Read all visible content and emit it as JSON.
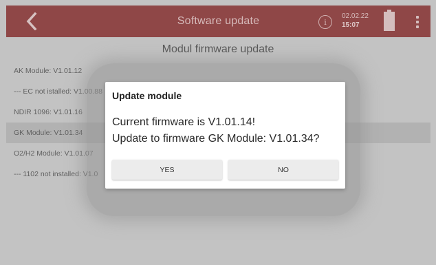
{
  "appbar": {
    "title": "Software update",
    "date": "02.02.22",
    "time": "15:07",
    "icons": [
      "chevron-left-icon",
      "info-icon",
      "battery-icon",
      "more-vertical-icon"
    ],
    "colors": {
      "bar": "#8a2a2a",
      "bar_text": "#e7c2c2"
    }
  },
  "page": {
    "heading": "Modul firmware update",
    "modules": [
      {
        "label": "AK Module: V1.01.12",
        "selected": false
      },
      {
        "label": "--- EC not istalled: V1.00.88",
        "selected": false
      },
      {
        "label": "NDIR 1096: V1.01.16",
        "selected": false
      },
      {
        "label": "GK Module: V1.01.34",
        "selected": true
      },
      {
        "label": "O2/H2 Module: V1.01.07",
        "selected": false
      },
      {
        "label": "--- 1102 not installed: V1.0",
        "selected": false
      }
    ]
  },
  "dialog": {
    "title": "Update module",
    "message_line1": "Current firmware is V1.01.14!",
    "message_line2": "Update to firmware GK Module: V1.01.34?",
    "yes_label": "YES",
    "no_label": "NO"
  }
}
